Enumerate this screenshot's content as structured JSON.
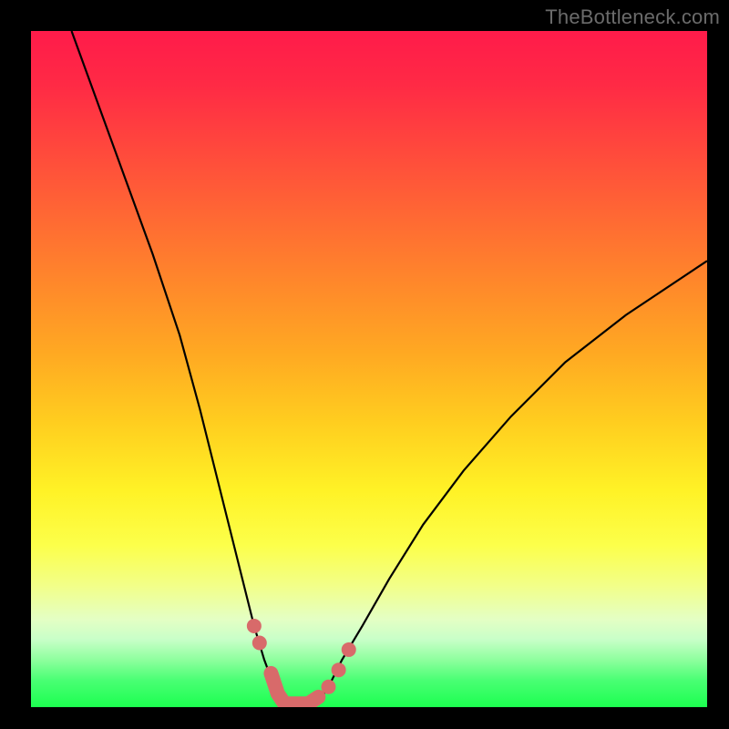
{
  "watermark": "TheBottleneck.com",
  "colors": {
    "frame": "#000000",
    "curve": "#000000",
    "marker": "#d86a6a",
    "gradient_top": "#ff1b4a",
    "gradient_bottom": "#1cff50"
  },
  "chart_data": {
    "type": "line",
    "title": "",
    "xlabel": "",
    "ylabel": "",
    "xlim": [
      0,
      100
    ],
    "ylim": [
      0,
      100
    ],
    "grid": false,
    "legend": false,
    "series": [
      {
        "name": "left-curve",
        "x": [
          6,
          10,
          14,
          18,
          22,
          25,
          27,
          29,
          31,
          33,
          34.5,
          36,
          37.5
        ],
        "y": [
          100,
          89,
          78,
          67,
          55,
          44,
          36,
          28,
          20,
          12,
          7,
          3,
          0
        ]
      },
      {
        "name": "right-curve",
        "x": [
          42,
          44,
          46,
          49,
          53,
          58,
          64,
          71,
          79,
          88,
          100
        ],
        "y": [
          0,
          3,
          7,
          12,
          19,
          27,
          35,
          43,
          51,
          58,
          66
        ]
      }
    ],
    "markers": [
      {
        "name": "left-dot-upper",
        "x": 33.0,
        "y": 12.0
      },
      {
        "name": "left-dot-lower",
        "x": 33.8,
        "y": 9.5
      },
      {
        "name": "right-dot-1",
        "x": 44.0,
        "y": 3.0
      },
      {
        "name": "right-dot-2",
        "x": 45.5,
        "y": 5.5
      },
      {
        "name": "right-dot-3",
        "x": 47.0,
        "y": 8.5
      }
    ],
    "valley_bar": {
      "x": [
        35.5,
        36.5,
        37.5,
        39.0,
        41.0,
        42.5
      ],
      "y": [
        5.0,
        2.0,
        0.5,
        0.5,
        0.5,
        1.5
      ]
    },
    "notes": "Plot depicts a V-shaped bottleneck curve over a vertical color gradient from red (high bottleneck) to green (low bottleneck). Axis values are estimated from pixel positions on a 0–100 normalized scale since no tick labels are rendered."
  }
}
